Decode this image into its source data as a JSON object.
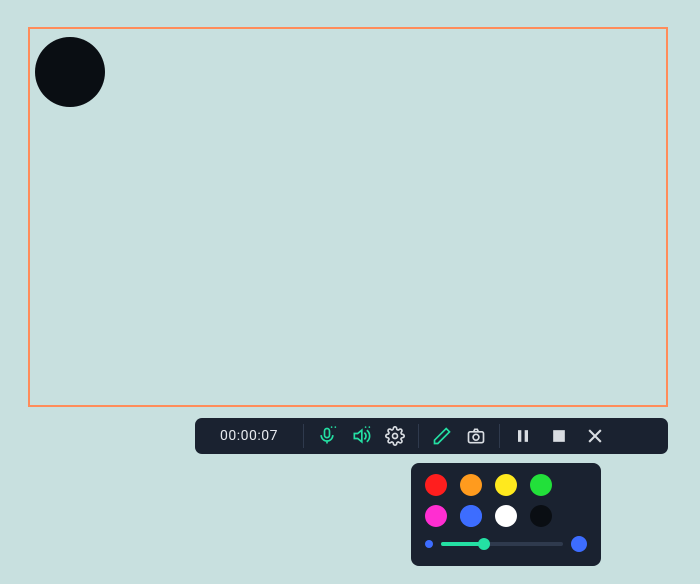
{
  "capture": {
    "border_color": "#ff8c5a"
  },
  "webcam": {
    "shape": "circle"
  },
  "toolbar": {
    "timer": "00:00:07",
    "mic_icon": "microphone",
    "speaker_icon": "speaker",
    "settings_icon": "gear",
    "draw_icon": "pencil",
    "screenshot_icon": "camera",
    "pause_icon": "pause",
    "stop_icon": "stop",
    "close_icon": "close",
    "accent_color": "#24e0a3"
  },
  "palette": {
    "rows": [
      [
        "#ff1e1e",
        "#ff9b1e",
        "#ffe91e",
        "#22e03a"
      ],
      [
        "#ff2ed1",
        "#3d6dff",
        "#ffffff",
        "#0a0e13"
      ]
    ],
    "selected_index": 5,
    "brush_size_percent": 35,
    "brush_min_color": "#3d6dff",
    "brush_max_color": "#3d6dff"
  }
}
